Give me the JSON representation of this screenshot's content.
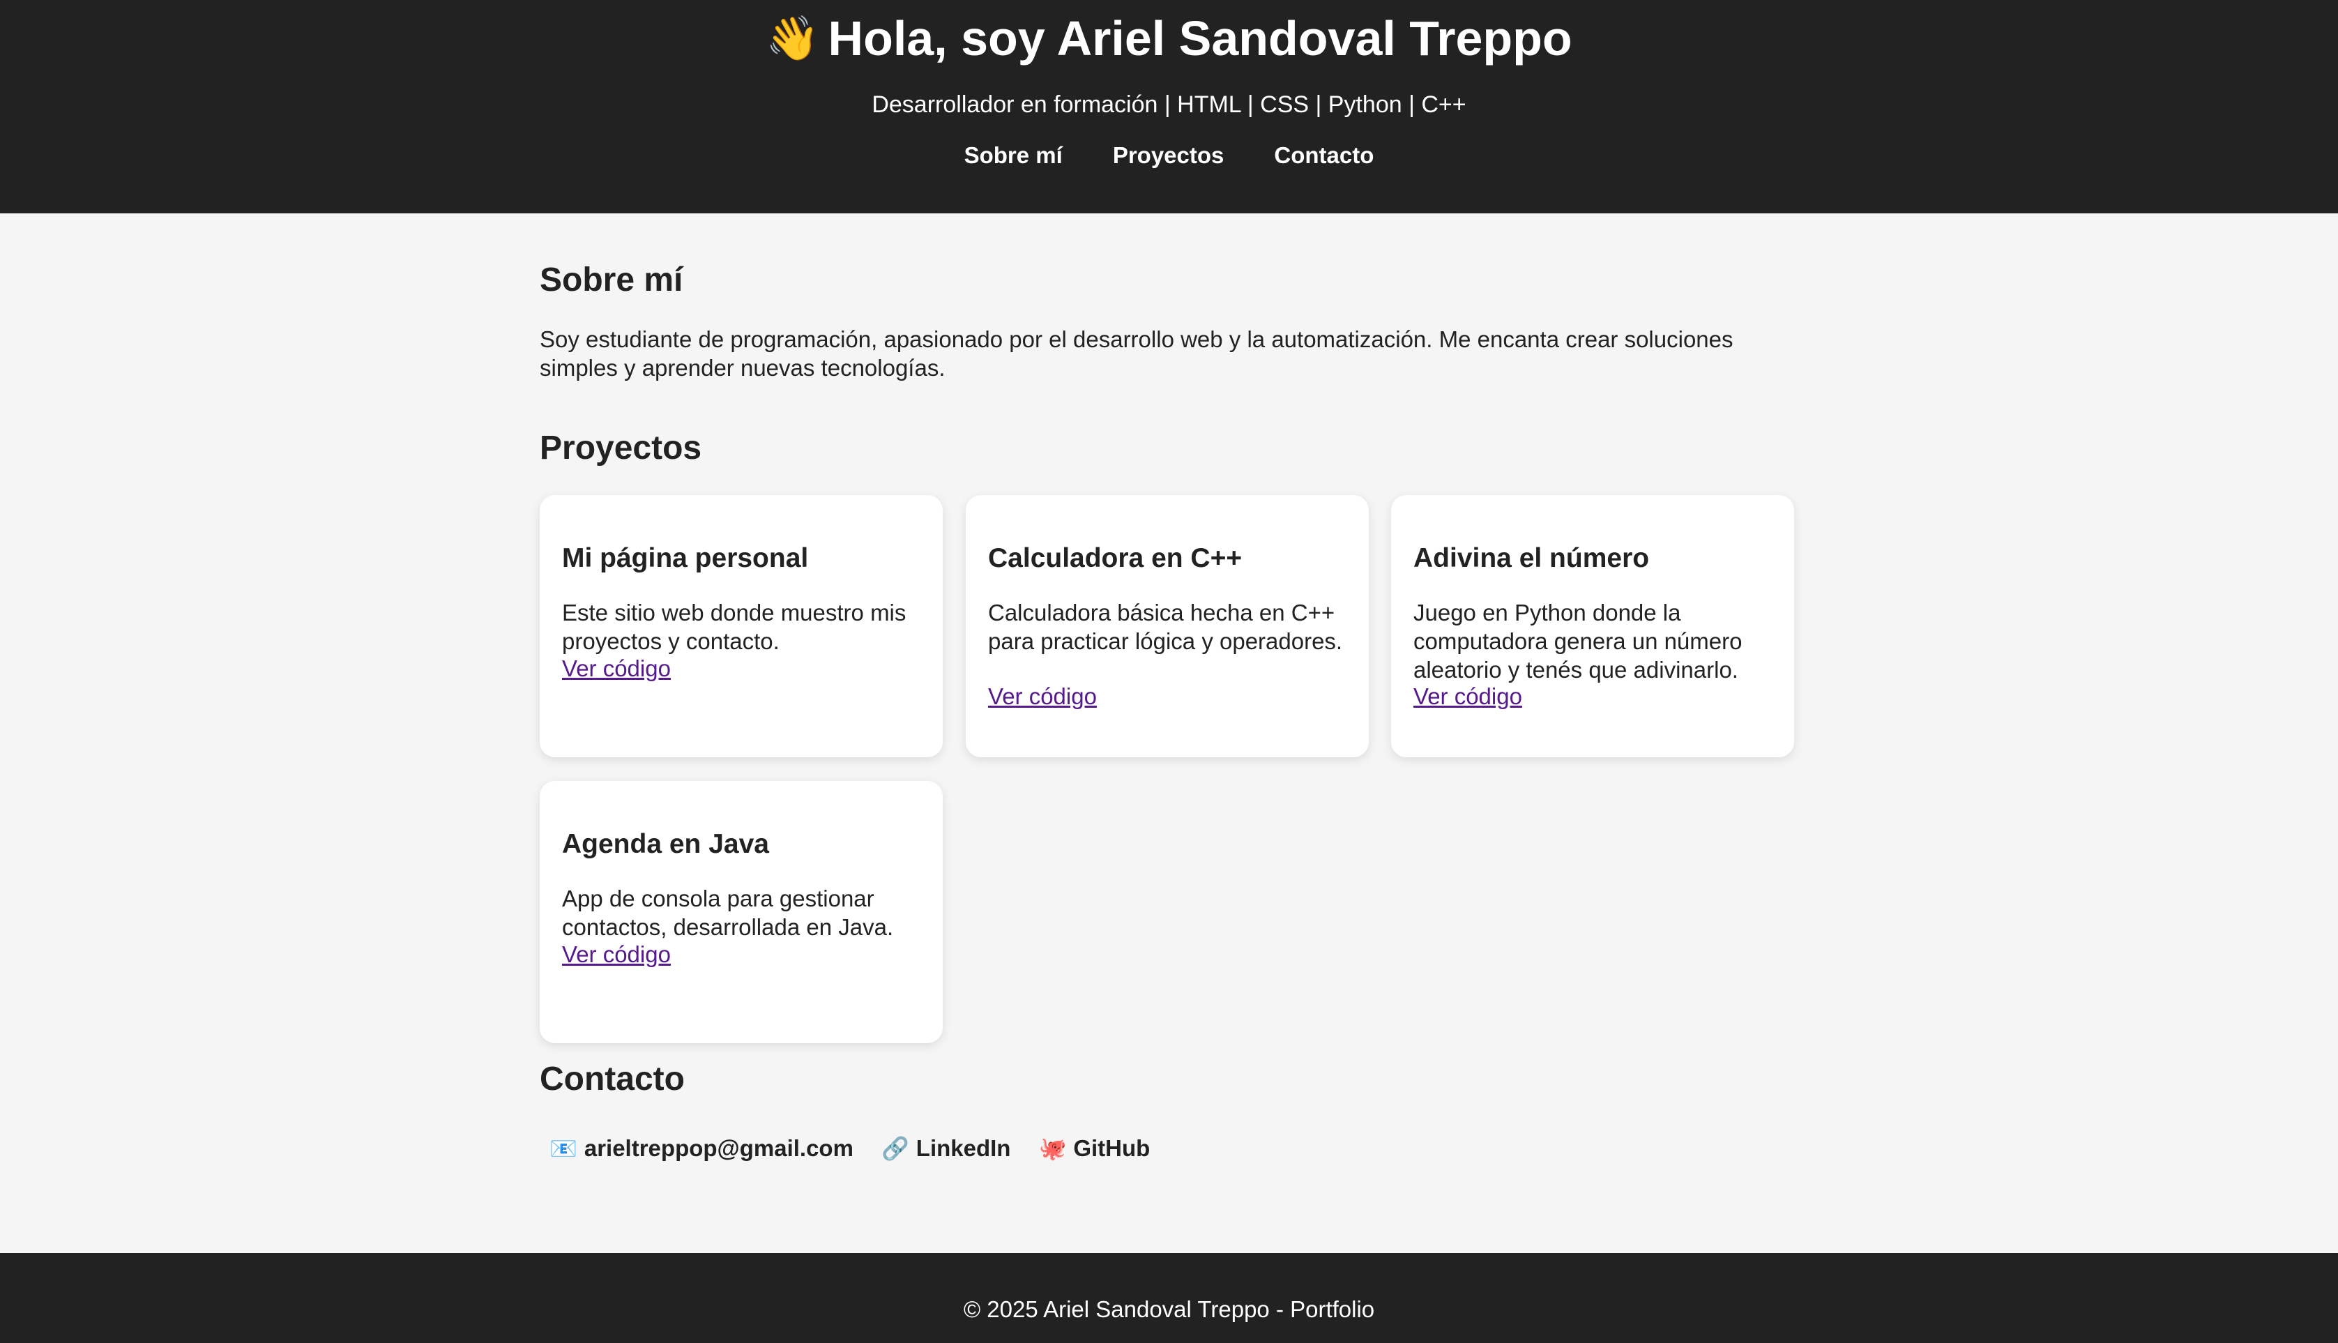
{
  "header": {
    "wave_icon": "👋",
    "title": "Hola, soy Ariel Sandoval Treppo",
    "subtitle": "Desarrollador en formación | HTML | CSS | Python | C++",
    "nav": [
      "Sobre mí",
      "Proyectos",
      "Contacto"
    ]
  },
  "about": {
    "title": "Sobre mí",
    "text": "Soy estudiante de programación, apasionado por el desarrollo web y la automatización. Me encanta crear soluciones simples y aprender nuevas tecnologías."
  },
  "projects": {
    "title": "Proyectos",
    "items": [
      {
        "title": "Mi página personal",
        "description": "Este sitio web donde muestro mis proyectos y contacto.",
        "link": "Ver código"
      },
      {
        "title": "Calculadora en C++",
        "description": "Calculadora básica hecha en C++ para practicar lógica y operadores.",
        "link": "Ver código"
      },
      {
        "title": "Adivina el número",
        "description": "Juego en Python donde la computadora genera un número aleatorio y tenés que adivinarlo.",
        "link": "Ver código"
      },
      {
        "title": "Agenda en Java",
        "description": "App de consola para gestionar contactos, desarrollada en Java.",
        "link": "Ver código"
      }
    ]
  },
  "contact": {
    "title": "Contacto",
    "email_icon": "📧",
    "email": "arieltreppop@gmail.com",
    "linkedin_icon": "🔗",
    "linkedin": "LinkedIn",
    "github_icon": "🐙",
    "github": "GitHub"
  },
  "footer": {
    "text": "© 2025 Ariel Sandoval Treppo - Portfolio"
  },
  "colors": {
    "header_bg": "#222222",
    "page_bg": "#f5f5f5",
    "card_bg": "#ffffff",
    "link": "#551a8b"
  }
}
